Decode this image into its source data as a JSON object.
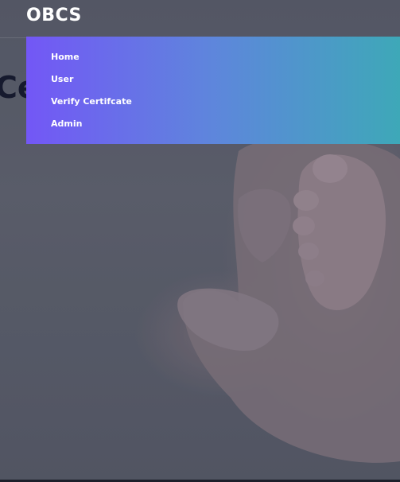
{
  "navbar": {
    "brand": "OBCS"
  },
  "hero": {
    "headline_partial": "Ce"
  },
  "dropdown": {
    "items": [
      {
        "label": "Home"
      },
      {
        "label": "User"
      },
      {
        "label": "Verify Certifcate"
      },
      {
        "label": "Admin"
      }
    ]
  },
  "colors": {
    "dropdown_gradient_start": "#7357f6",
    "dropdown_gradient_mid": "#5e86dc",
    "dropdown_gradient_end": "#3ea8b8",
    "overlay": "#5a5d6a",
    "headline": "#161a2e"
  }
}
